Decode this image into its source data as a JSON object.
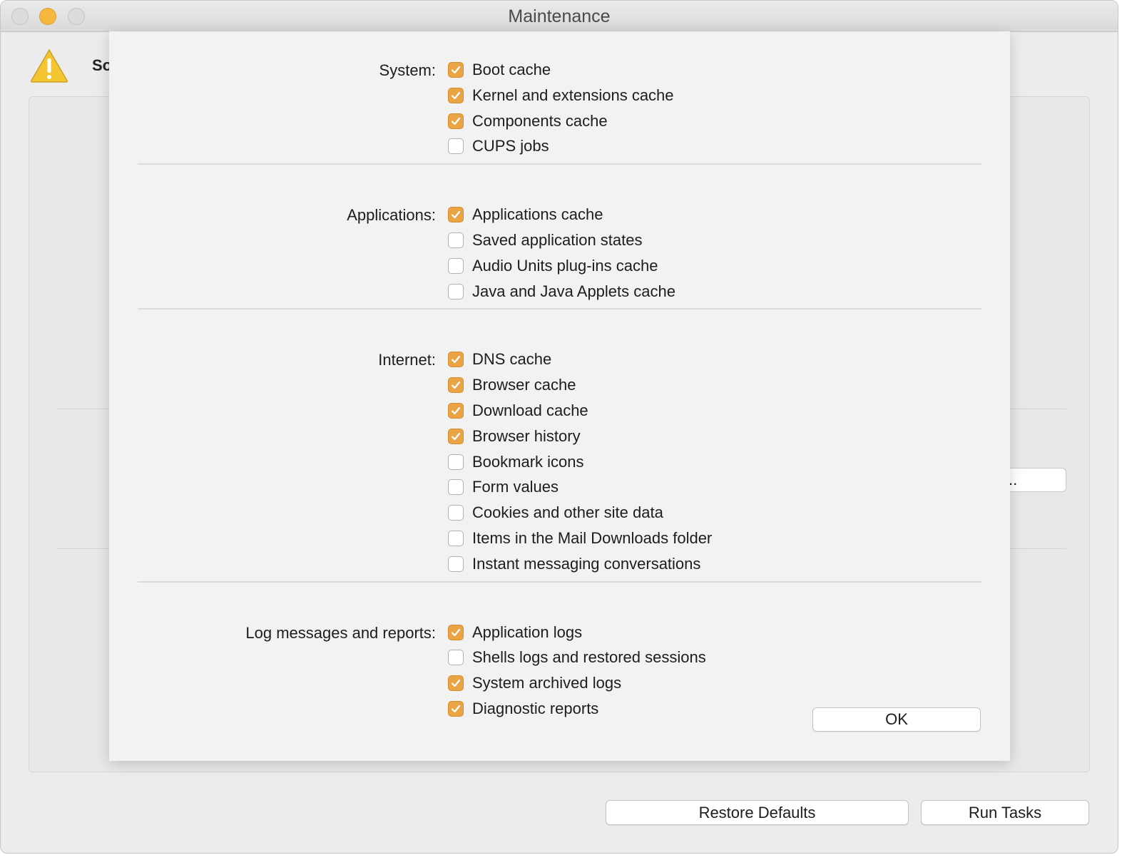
{
  "window": {
    "title": "Maintenance"
  },
  "background": {
    "warning_text": "So",
    "hidden_button_label": "..",
    "restore_defaults_label": "Restore Defaults",
    "run_tasks_label": "Run Tasks"
  },
  "sheet": {
    "ok_label": "OK",
    "sections": [
      {
        "label": "System:",
        "items": [
          {
            "label": "Boot cache",
            "checked": true
          },
          {
            "label": "Kernel and extensions cache",
            "checked": true
          },
          {
            "label": "Components cache",
            "checked": true
          },
          {
            "label": "CUPS jobs",
            "checked": false
          }
        ]
      },
      {
        "label": "Applications:",
        "items": [
          {
            "label": "Applications cache",
            "checked": true
          },
          {
            "label": "Saved application states",
            "checked": false
          },
          {
            "label": "Audio Units plug-ins cache",
            "checked": false
          },
          {
            "label": "Java and Java Applets cache",
            "checked": false
          }
        ]
      },
      {
        "label": "Internet:",
        "items": [
          {
            "label": "DNS cache",
            "checked": true
          },
          {
            "label": "Browser cache",
            "checked": true
          },
          {
            "label": "Download cache",
            "checked": true
          },
          {
            "label": "Browser history",
            "checked": true
          },
          {
            "label": "Bookmark icons",
            "checked": false
          },
          {
            "label": "Form values",
            "checked": false
          },
          {
            "label": "Cookies and other site data",
            "checked": false
          },
          {
            "label": "Items in the Mail Downloads folder",
            "checked": false
          },
          {
            "label": "Instant messaging conversations",
            "checked": false
          }
        ]
      },
      {
        "label": "Log messages and reports:",
        "items": [
          {
            "label": "Application logs",
            "checked": true
          },
          {
            "label": "Shells logs and restored sessions",
            "checked": false
          },
          {
            "label": "System archived logs",
            "checked": true
          },
          {
            "label": "Diagnostic reports",
            "checked": true
          }
        ]
      }
    ]
  },
  "colors": {
    "accent": "#eba445",
    "window_bg": "#ececec",
    "sheet_bg": "#f2f2f2"
  }
}
